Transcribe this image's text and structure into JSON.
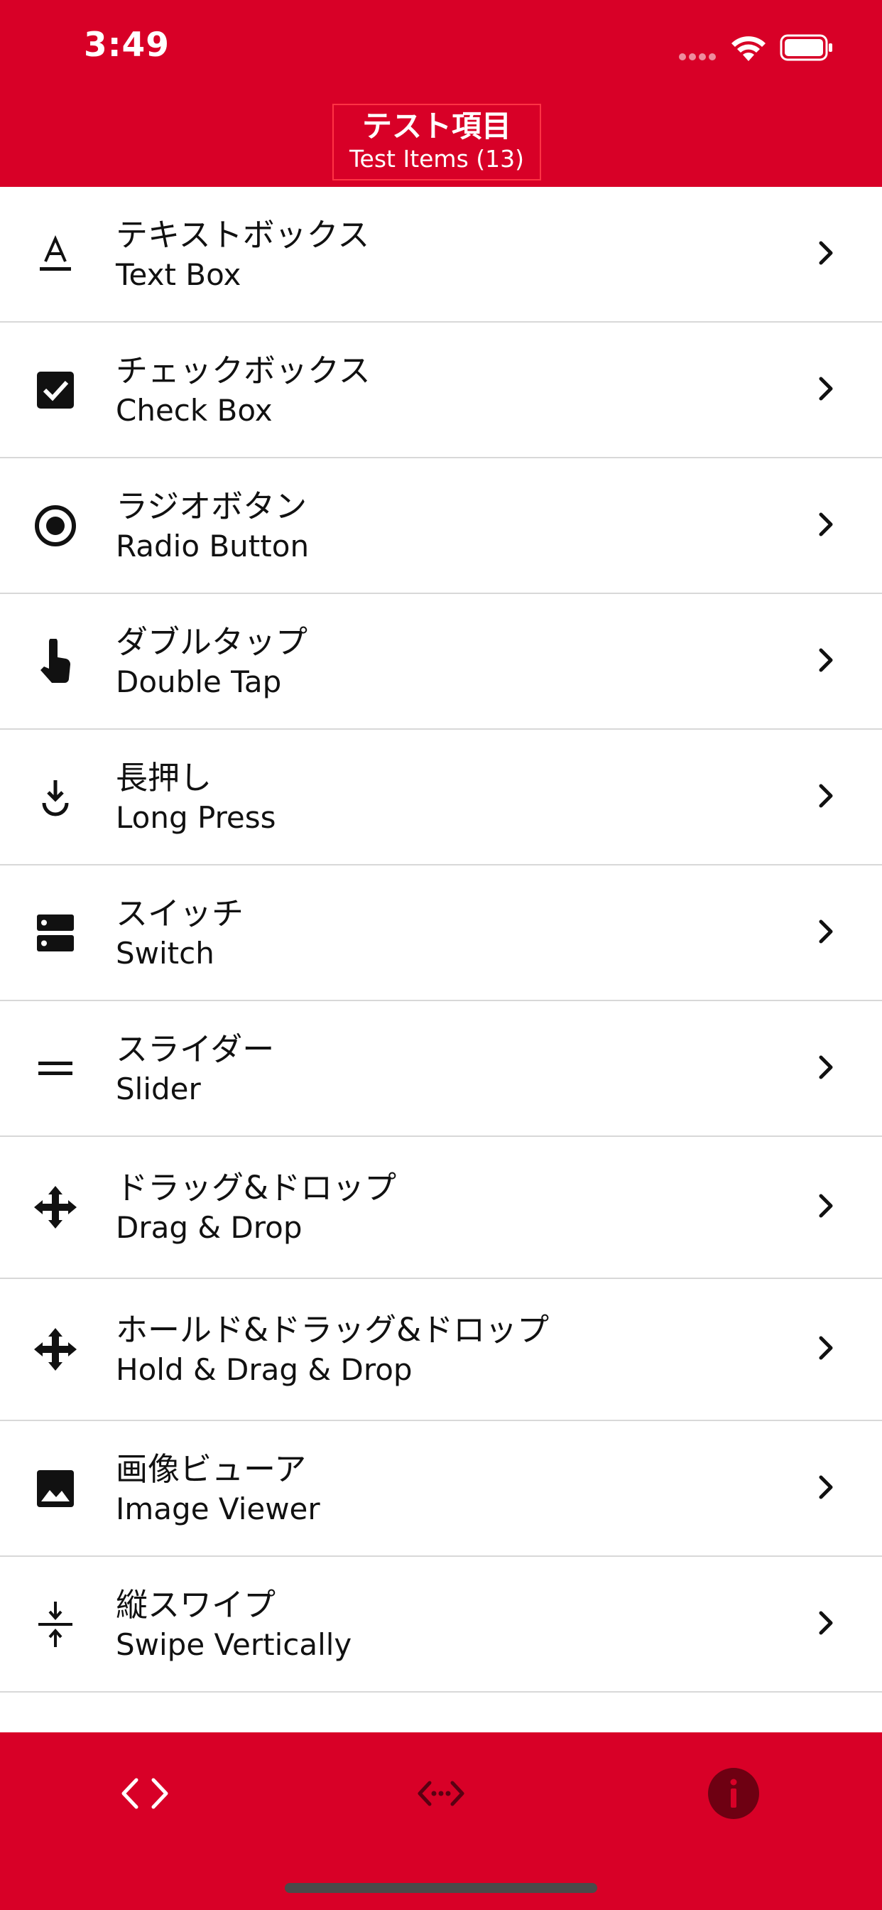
{
  "status_bar": {
    "time": "3:49"
  },
  "header": {
    "title_jp": "テスト項目",
    "title_en": "Test Items (13)"
  },
  "items": [
    {
      "jp": "テキストボックス",
      "en": "Text Box",
      "icon": "text-format-icon"
    },
    {
      "jp": "チェックボックス",
      "en": "Check Box",
      "icon": "checkbox-icon"
    },
    {
      "jp": "ラジオボタン",
      "en": "Radio Button",
      "icon": "radio-button-icon"
    },
    {
      "jp": "ダブルタップ",
      "en": "Double Tap",
      "icon": "touch-hand-icon"
    },
    {
      "jp": "長押し",
      "en": "Long Press",
      "icon": "long-press-icon"
    },
    {
      "jp": "スイッチ",
      "en": "Switch",
      "icon": "switch-icon"
    },
    {
      "jp": "スライダー",
      "en": "Slider",
      "icon": "slider-icon"
    },
    {
      "jp": "ドラッグ&ドロップ",
      "en": "Drag & Drop",
      "icon": "move-arrows-icon"
    },
    {
      "jp": "ホールド&ドラッグ&ドロップ",
      "en": "Hold & Drag & Drop",
      "icon": "move-arrows-icon"
    },
    {
      "jp": "画像ビューア",
      "en": "Image Viewer",
      "icon": "image-icon"
    },
    {
      "jp": "縦スワイプ",
      "en": "Swipe Vertically",
      "icon": "vertical-swipe-icon"
    }
  ],
  "tabbar": {
    "tabs": [
      {
        "name": "code-tab",
        "icon": "code-brackets-icon"
      },
      {
        "name": "dotted-code-tab",
        "icon": "dotted-code-icon"
      },
      {
        "name": "info-tab",
        "icon": "info-icon"
      }
    ]
  },
  "colors": {
    "accent": "#d80027",
    "divider": "#d8d8d8",
    "text": "#111111"
  }
}
